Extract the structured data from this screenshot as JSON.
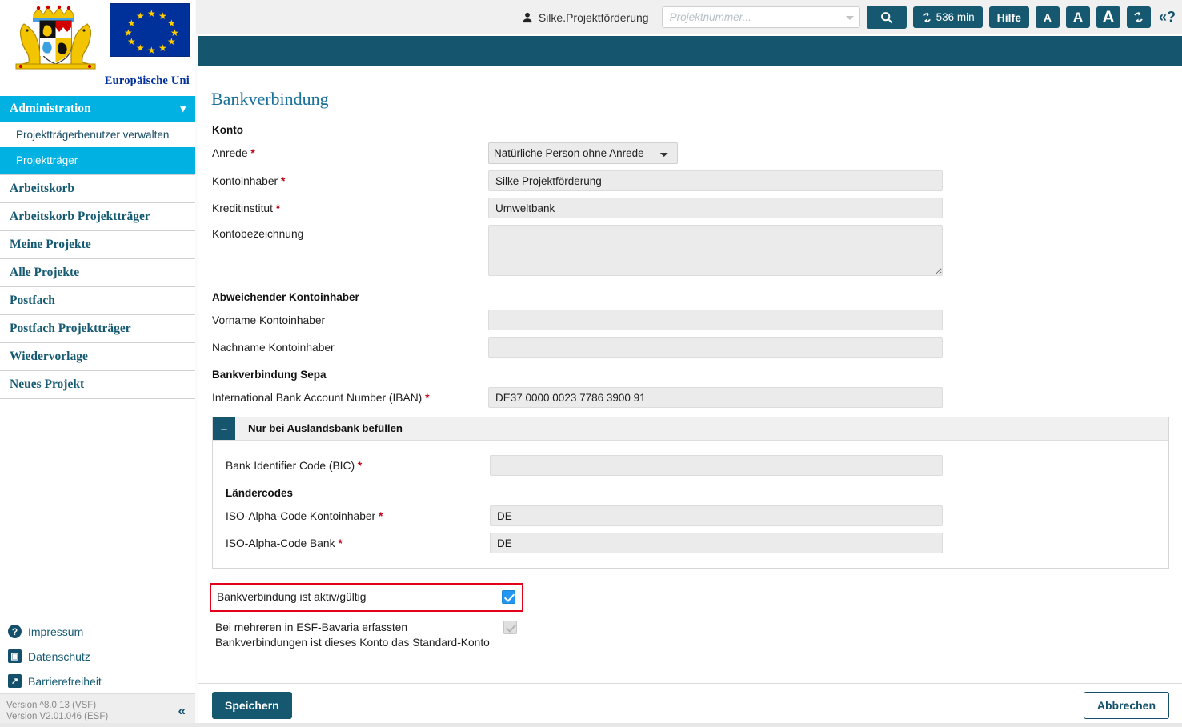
{
  "branding": {
    "crest_alt": "bavaria-coat-of-arms",
    "eu_flag_alt": "european-union-flag",
    "eu_caption": "Europäische Uni"
  },
  "topbar": {
    "user_name": "Silke.Projektförderung",
    "search_placeholder": "Projektnummer...",
    "search_value": "",
    "search_button_icon": "search-icon",
    "session_timer": "536 min",
    "help_label": "Hilfe",
    "font_small": "A",
    "font_medium": "A",
    "font_large": "A",
    "refresh_icon": "refresh-icon",
    "help_toggle": "«?"
  },
  "sidebar": {
    "group": {
      "label": "Administration",
      "chevron": "chevron-down-icon"
    },
    "sub_items": [
      {
        "label": "Projektträgerbenutzer verwalten",
        "active": false
      },
      {
        "label": "Projektträger",
        "active": true
      }
    ],
    "items": [
      {
        "label": "Arbeitskorb"
      },
      {
        "label": "Arbeitskorb Projektträger"
      },
      {
        "label": "Meine Projekte"
      },
      {
        "label": "Alle Projekte"
      },
      {
        "label": "Postfach"
      },
      {
        "label": "Postfach Projektträger"
      },
      {
        "label": "Wiedervorlage"
      },
      {
        "label": "Neues Projekt"
      }
    ],
    "footer_links": [
      {
        "label": "Impressum",
        "icon": "question-mark-icon",
        "glyph": "?"
      },
      {
        "label": "Datenschutz",
        "icon": "privacy-badge-icon",
        "glyph": "▤"
      },
      {
        "label": "Barrierefreiheit",
        "icon": "accessibility-arrow-icon",
        "glyph": "↗"
      }
    ],
    "version_line_1": "Version ^8.0.13 (VSF)",
    "version_line_2": "Version V2.01.046 (ESF)",
    "collapse_glyph": "«"
  },
  "main": {
    "title": "Bankverbindung",
    "konto_heading": "Konto",
    "anrede": {
      "label": "Anrede",
      "required": "*",
      "value": "Natürliche Person ohne Anrede",
      "options": [
        "Natürliche Person ohne Anrede"
      ]
    },
    "kontoinhaber": {
      "label": "Kontoinhaber",
      "required": "*",
      "value": "Silke Projektförderung"
    },
    "kreditinstitut": {
      "label": "Kreditinstitut",
      "required": "*",
      "value": "Umweltbank"
    },
    "kontobezeichnung": {
      "label": "Kontobezeichnung",
      "required": "",
      "value": ""
    },
    "abweichend_heading": "Abweichender Kontoinhaber",
    "vorname": {
      "label": "Vorname Kontoinhaber",
      "required": "",
      "value": ""
    },
    "nachname": {
      "label": "Nachname Kontoinhaber",
      "required": "",
      "value": ""
    },
    "sepa_heading": "Bankverbindung Sepa",
    "iban": {
      "label": "International Bank Account Number (IBAN)",
      "required": "*",
      "value": "DE37 0000 0023 7786 3900 91"
    },
    "panel": {
      "toggle_glyph": "–",
      "title": "Nur bei Auslandsbank befüllen",
      "bic": {
        "label": "Bank Identifier Code (BIC)",
        "required": "*",
        "value": ""
      },
      "laendercodes_heading": "Ländercodes",
      "iso_kontoinhaber": {
        "label": "ISO-Alpha-Code Kontoinhaber",
        "required": "*",
        "value": "DE"
      },
      "iso_bank": {
        "label": "ISO-Alpha-Code Bank",
        "required": "*",
        "value": "DE"
      }
    },
    "checkbox_active": {
      "label": "Bankverbindung ist aktiv/gültig",
      "checked": true,
      "highlighted": true,
      "highlight_color": "#e4001b"
    },
    "checkbox_standard": {
      "label_line_1": "Bei mehreren in ESF-Bavaria erfassten",
      "label_line_2": "Bankverbindungen ist dieses Konto das Standard-Konto",
      "checked": true,
      "disabled": true
    }
  },
  "actions": {
    "save_label": "Speichern",
    "cancel_label": "Abbrechen"
  },
  "colors": {
    "teal": "#15566e",
    "cyan": "#00b1e1",
    "link_blue": "#155a72",
    "title_blue": "#1a7099",
    "required_red": "#c00418",
    "highlight_red": "#e4001b",
    "checkbox_blue": "#2196f3"
  }
}
